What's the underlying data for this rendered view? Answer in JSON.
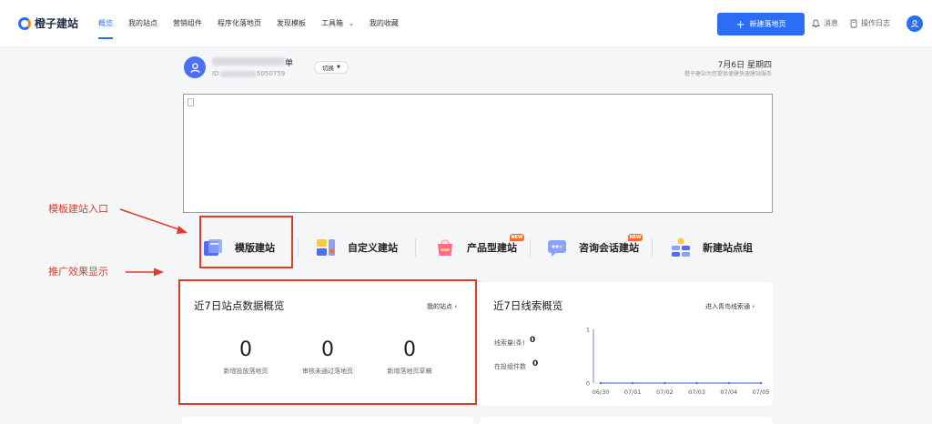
{
  "brand": {
    "name": "橙子建站"
  },
  "nav": {
    "items": [
      {
        "label": "概览",
        "active": true
      },
      {
        "label": "我的站点"
      },
      {
        "label": "营销组件"
      },
      {
        "label": "程序化落地页"
      },
      {
        "label": "发现模板"
      },
      {
        "label": "工具箱",
        "dropdown": true
      },
      {
        "label": "我的收藏"
      }
    ],
    "new_button": "新建落地页",
    "messages": "消息",
    "oplog": "操作日志"
  },
  "user": {
    "name_tail": "单",
    "id_label": "ID:",
    "id_tail": "5050759",
    "switch_label": "切换"
  },
  "date": {
    "day": "7月6日 星期四",
    "subtitle": "橙子建站为您提供便捷快速建站服务"
  },
  "build_options": [
    {
      "label": "模版建站",
      "icon": "template-build-icon"
    },
    {
      "label": "自定义建站",
      "icon": "custom-build-icon"
    },
    {
      "label": "产品型建站",
      "icon": "product-build-icon",
      "badge": "NEW"
    },
    {
      "label": "咨询会话建站",
      "icon": "consult-build-icon",
      "badge": "NEW"
    },
    {
      "label": "新建站点组",
      "icon": "site-group-icon"
    }
  ],
  "annotations": {
    "entry": "模板建站入口",
    "effect": "推广效果显示",
    "color": "#e33b2a"
  },
  "site_overview": {
    "title": "近7日站点数据概览",
    "link": "我的站点",
    "stats": [
      {
        "value": "0",
        "label": "新增投放落地页"
      },
      {
        "value": "0",
        "label": "审核未通过落地页"
      },
      {
        "value": "0",
        "label": "新增落地页草稿"
      }
    ]
  },
  "lead_overview": {
    "title": "近7日线索概览",
    "link": "进入青鸟线索通",
    "metrics": [
      {
        "label": "线索量(条)",
        "value": "0"
      },
      {
        "label": "在投组件数",
        "value": "0"
      }
    ]
  },
  "chart_data": {
    "type": "line",
    "x": [
      "06/30",
      "07/01",
      "07/02",
      "07/03",
      "07/04",
      "07/05"
    ],
    "series": [
      {
        "values": [
          0,
          0,
          0,
          0,
          0,
          0
        ]
      }
    ],
    "y_ticks": [
      "0",
      "1"
    ],
    "ylim": [
      0,
      1
    ],
    "color": "#5b7cfa"
  },
  "colors": {
    "accent": "#2c6df6",
    "badge": "#ff6a2b"
  }
}
